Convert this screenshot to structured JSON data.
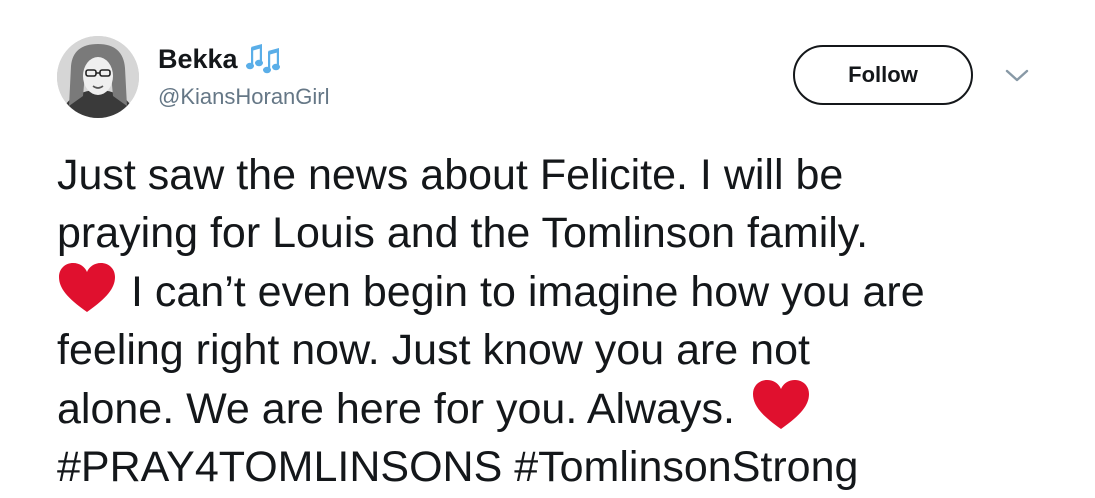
{
  "user": {
    "display_name": "Bekka",
    "handle": "@KiansHoranGirl",
    "name_emoji": "musical-notes-emoji"
  },
  "actions": {
    "follow_label": "Follow",
    "menu_icon": "chevron-down-icon"
  },
  "tweet": {
    "line1": "Just saw the news about Felicite. I will be",
    "line2": "praying for Louis and the Tomlinson family.",
    "line3": "I can’t even begin to imagine how you are",
    "line4": "feeling right now. Just know you are not",
    "line5": "alone. We are here for you. Always.",
    "hashtag1": "#PRAY4TOMLINSONS",
    "hashtag2": "#TomlinsonStrong",
    "emoji": "red-heart-emoji"
  },
  "colors": {
    "text": "#14171a",
    "secondary_text": "#657786",
    "heart": "#e0102e",
    "music_note": "#5aaee8"
  }
}
